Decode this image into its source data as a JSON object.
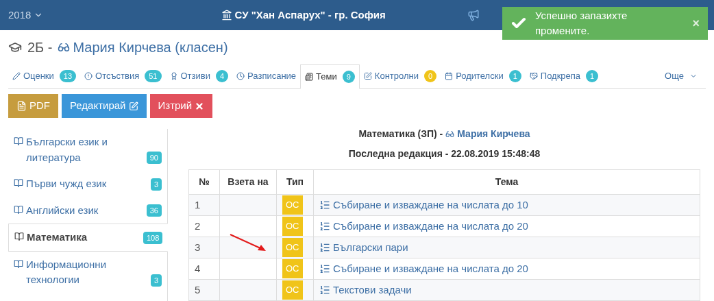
{
  "header": {
    "year": "2018",
    "school": "СУ \"Хан Аспарух\" - гр. София"
  },
  "toast": {
    "message": "Успешно запазихте промените.",
    "close": "×"
  },
  "heading": {
    "class_label": "2Б -",
    "teacher": "Мария Кирчева (класен)"
  },
  "tabs": [
    {
      "label": "Оценки",
      "count": "13",
      "color": "#3bbfd0",
      "selected": false
    },
    {
      "label": "Отсъствия",
      "count": "51",
      "color": "#3bbfd0",
      "selected": false
    },
    {
      "label": "Отзиви",
      "count": "4",
      "color": "#3bbfd0",
      "selected": false
    },
    {
      "label": "Разписание",
      "selected": false
    },
    {
      "label": "Теми",
      "count": "9",
      "color": "#3bbfd0",
      "selected": true
    },
    {
      "label": "Контролни",
      "count": "0",
      "color": "#f0c419",
      "selected": false
    },
    {
      "label": "Родителски",
      "count": "1",
      "color": "#3bbfd0",
      "selected": false
    },
    {
      "label": "Подкрепа",
      "count": "1",
      "color": "#3bbfd0",
      "selected": false
    }
  ],
  "more_menu": {
    "label": "Още"
  },
  "buttons": [
    {
      "kind": "pdf",
      "label": "PDF"
    },
    {
      "kind": "edit",
      "label": "Редактирай"
    },
    {
      "kind": "delete",
      "label": "Изтрий"
    }
  ],
  "subjects": [
    {
      "label": "Български език и литература",
      "count": "90",
      "selected": false
    },
    {
      "label": "Първи чужд език",
      "count": "3",
      "selected": false
    },
    {
      "label": "Английски език",
      "count": "36",
      "selected": false
    },
    {
      "label": "Математика",
      "count": "108",
      "selected": true
    },
    {
      "label": "Информационни технологии",
      "count": "3",
      "selected": false
    }
  ],
  "content": {
    "subject": "Математика (ЗП) -",
    "teacher": "Мария Кирчева",
    "last_edit": "Последна редакция - 22.08.2019 15:48:48"
  },
  "table": {
    "columns": [
      "№",
      "Взета на",
      "Тип",
      "Тема"
    ],
    "rows": [
      {
        "number": "1",
        "type": "ОС",
        "topic": "Събиране и изваждане на числата до 10"
      },
      {
        "number": "2",
        "type": "ОС",
        "topic": "Събиране и изваждане на числата до 20"
      },
      {
        "number": "3",
        "type": "ОС",
        "topic": "Български пари"
      },
      {
        "number": "4",
        "type": "ОС",
        "topic": "Събиране и изваждане на числата до 20"
      },
      {
        "number": "5",
        "type": "ОС",
        "topic": "Текстови задачи"
      }
    ]
  }
}
